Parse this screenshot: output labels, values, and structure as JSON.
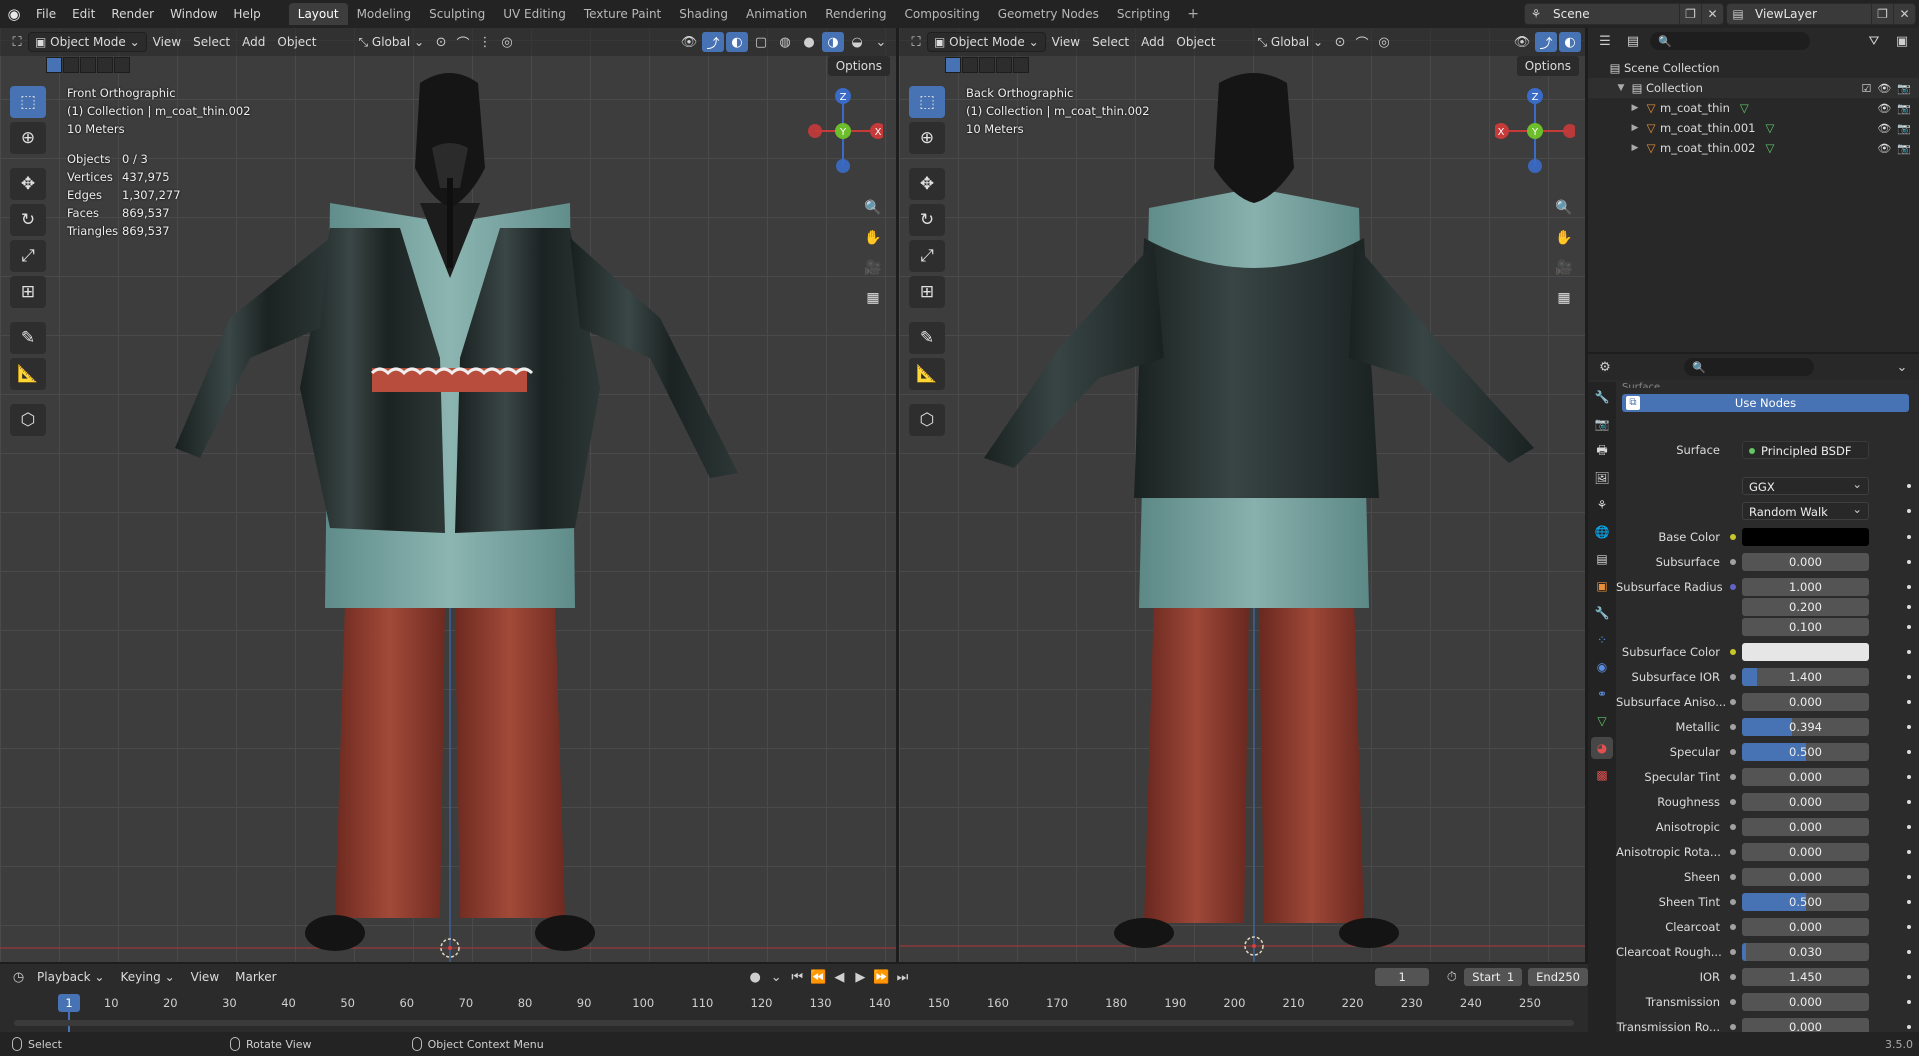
{
  "topbar": {
    "menus": [
      "File",
      "Edit",
      "Render",
      "Window",
      "Help"
    ],
    "workspaces": [
      "Layout",
      "Modeling",
      "Sculpting",
      "UV Editing",
      "Texture Paint",
      "Shading",
      "Animation",
      "Rendering",
      "Compositing",
      "Geometry Nodes",
      "Scripting"
    ],
    "active_workspace": "Layout",
    "scene": "Scene",
    "view_layer": "ViewLayer"
  },
  "viewport_left": {
    "mode": "Object Mode",
    "menus": [
      "View",
      "Select",
      "Add",
      "Object"
    ],
    "transform": "Global",
    "options": "Options",
    "view_name": "Front Orthographic",
    "collection": "(1) Collection | m_coat_thin.002",
    "scale": "10 Meters",
    "stats": [
      {
        "k": "Objects",
        "v": "0 / 3"
      },
      {
        "k": "Vertices",
        "v": "437,975"
      },
      {
        "k": "Edges",
        "v": "1,307,277"
      },
      {
        "k": "Faces",
        "v": "869,537"
      },
      {
        "k": "Triangles",
        "v": "869,537"
      }
    ]
  },
  "viewport_right": {
    "mode": "Object Mode",
    "menus": [
      "View",
      "Select",
      "Add",
      "Object"
    ],
    "transform": "Global",
    "options": "Options",
    "view_name": "Back Orthographic",
    "collection": "(1) Collection | m_coat_thin.002",
    "scale": "10 Meters"
  },
  "gizmo": {
    "x": "X",
    "y": "Y",
    "z": "Z"
  },
  "outliner": {
    "root": "Scene Collection",
    "collection": "Collection",
    "objects": [
      "m_coat_thin",
      "m_coat_thin.001",
      "m_coat_thin.002"
    ]
  },
  "properties": {
    "panel": "Surface",
    "use_nodes": "Use Nodes",
    "surface_label": "Surface",
    "surface_value": "Principled BSDF",
    "distribution": "GGX",
    "subsurface_method": "Random Walk",
    "rows": [
      {
        "label": "Base Color",
        "type": "black",
        "sock": "y"
      },
      {
        "label": "Subsurface",
        "value": "0.000",
        "fill": 0
      },
      {
        "label": "Subsurface Radius",
        "value": "1.000",
        "sock": "b",
        "fill": 0
      },
      {
        "label": "",
        "value": "0.200",
        "nosock": true,
        "fill": 0
      },
      {
        "label": "",
        "value": "0.100",
        "nosock": true,
        "fill": 0
      },
      {
        "label": "Subsurface Color",
        "type": "white",
        "sock": "y"
      },
      {
        "label": "Subsurface IOR",
        "value": "1.400",
        "fill": 0.12
      },
      {
        "label": "Subsurface Aniso...",
        "value": "0.000",
        "fill": 0
      },
      {
        "label": "Metallic",
        "value": "0.394",
        "fill": 0.394
      },
      {
        "label": "Specular",
        "value": "0.500",
        "fill": 0.5
      },
      {
        "label": "Specular Tint",
        "value": "0.000",
        "fill": 0
      },
      {
        "label": "Roughness",
        "value": "0.000",
        "fill": 0
      },
      {
        "label": "Anisotropic",
        "value": "0.000",
        "fill": 0
      },
      {
        "label": "Anisotropic Rota...",
        "value": "0.000",
        "fill": 0
      },
      {
        "label": "Sheen",
        "value": "0.000",
        "fill": 0
      },
      {
        "label": "Sheen Tint",
        "value": "0.500",
        "fill": 0.5
      },
      {
        "label": "Clearcoat",
        "value": "0.000",
        "fill": 0
      },
      {
        "label": "Clearcoat Rough...",
        "value": "0.030",
        "fill": 0.03
      },
      {
        "label": "IOR",
        "value": "1.450",
        "fill": 0
      },
      {
        "label": "Transmission",
        "value": "0.000",
        "fill": 0
      },
      {
        "label": "Transmission Ro...",
        "value": "0.000",
        "fill": 0
      }
    ]
  },
  "timeline": {
    "menus": [
      "Playback",
      "Keying",
      "View",
      "Marker"
    ],
    "current": "1",
    "start_label": "Start",
    "start": "1",
    "end_label": "End",
    "end": "250",
    "ticks": [
      "1",
      "10",
      "20",
      "30",
      "40",
      "50",
      "60",
      "70",
      "80",
      "90",
      "100",
      "110",
      "120",
      "130",
      "140",
      "150",
      "160",
      "170",
      "180",
      "190",
      "200",
      "210",
      "220",
      "230",
      "240",
      "250"
    ]
  },
  "statusbar": {
    "select": "Select",
    "rotate": "Rotate View",
    "context": "Object Context Menu",
    "version": "3.5.0"
  },
  "colors": {
    "accent": "#4772b3",
    "leather": "#1f2a2a",
    "shirt": "#6f9b98",
    "pants": "#8a3b2e"
  }
}
